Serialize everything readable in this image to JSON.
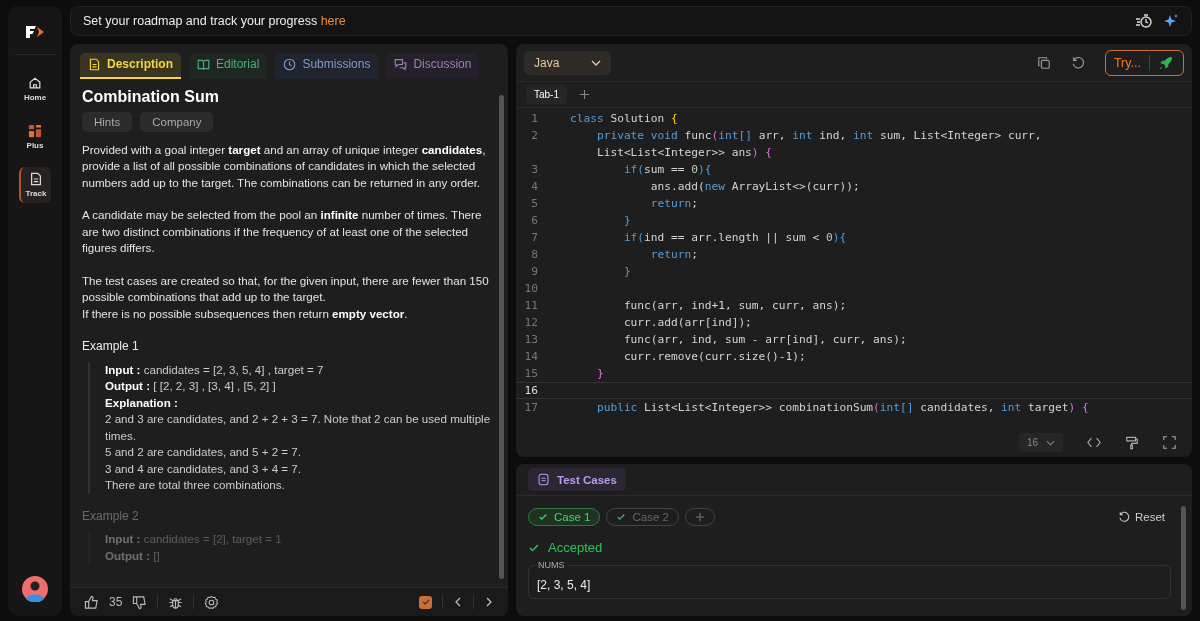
{
  "sidebar": {
    "items": [
      {
        "label": "Home",
        "kind": "home",
        "selected": false
      },
      {
        "label": "Plus",
        "kind": "plus",
        "selected": false
      },
      {
        "label": "Track",
        "kind": "track",
        "selected": true
      }
    ]
  },
  "banner": {
    "text": "Set your roadmap and track your progress",
    "link": "here"
  },
  "problem": {
    "tabs": [
      {
        "label": "Description",
        "kind": "description",
        "selected": true
      },
      {
        "label": "Editorial",
        "kind": "editorial",
        "selected": false
      },
      {
        "label": "Submissions",
        "kind": "submissions",
        "selected": false
      },
      {
        "label": "Discussion",
        "kind": "discussion",
        "selected": false
      }
    ],
    "title": "Combination Sum",
    "chips": [
      "Hints",
      "Company"
    ],
    "paragraphs": [
      [
        "Provided with a goal integer **target** and an array of unique integer **candidates**, provide a list of all possible combinations of candidates in which the selected numbers add up to the target. The combinations can be returned in any order."
      ],
      [
        "A candidate may be selected from the pool an **infinite** number of times. There are two distinct combinations if the frequency of at least one of the selected figures differs."
      ],
      [
        "The test cases are created so that, for the given input, there are fewer than 150 possible combinations that add up to the target.",
        "If there is no possible subsequences then return **empty vector**."
      ]
    ],
    "examples": [
      {
        "title": "Example 1",
        "faded": false,
        "lines": [
          "**Input :** candidates = [2, 3, 5, 4] , target = 7",
          "**Output :** [ [2, 2, 3] , [3, 4] , [5, 2] ]",
          "**Explanation :**",
          "2 and 3 are candidates, and 2 + 2 + 3 = 7. Note that 2 can be used multiple times.",
          "5 and 2 are candidates, and 5 + 2 = 7.",
          "3 and 4 are candidates, and 3 + 4 = 7.",
          "There are total three combinations."
        ]
      },
      {
        "title": "Example 2",
        "faded": true,
        "lines": [
          "**Input :** candidates = [2], target = 1",
          "**Output :** []"
        ]
      }
    ],
    "likes": "35",
    "solved": true
  },
  "editor": {
    "language": "Java",
    "try_button": "Try...",
    "tabs": [
      {
        "label": "Tab-1",
        "selected": true
      }
    ],
    "font_size": "16",
    "lines": [
      {
        "num": "1",
        "active": false,
        "tokens": [
          {
            "text": "class",
            "kind": "keyword"
          },
          {
            "text": " Solution ",
            "kind": "plain"
          },
          {
            "text": "{",
            "kind": "bracket1"
          }
        ]
      },
      {
        "num": "2",
        "active": false,
        "tokens": [
          {
            "text": "    private void",
            "kind": "keyword"
          },
          {
            "text": " func",
            "kind": "plain"
          },
          {
            "text": "(",
            "kind": "bracket2"
          },
          {
            "text": "int[]",
            "kind": "keyword"
          },
          {
            "text": " arr, ",
            "kind": "plain"
          },
          {
            "text": "int",
            "kind": "keyword"
          },
          {
            "text": " ind, ",
            "kind": "plain"
          },
          {
            "text": "int",
            "kind": "keyword"
          },
          {
            "text": " sum, List<Integer> curr,",
            "kind": "plain"
          }
        ]
      },
      {
        "active": false,
        "tokens": [
          {
            "text": "    List<List<Integer>> ans",
            "kind": "plain"
          },
          {
            "text": ") {",
            "kind": "bracket2"
          }
        ]
      },
      {
        "num": "3",
        "active": false,
        "tokens": [
          {
            "text": "        if",
            "kind": "keyword"
          },
          {
            "text": "(",
            "kind": "bracket3"
          },
          {
            "text": "sum == ",
            "kind": "plain"
          },
          {
            "text": "0",
            "kind": "number"
          },
          {
            "text": "){",
            "kind": "bracket3"
          }
        ]
      },
      {
        "num": "4",
        "active": false,
        "tokens": [
          {
            "text": "            ans.add(",
            "kind": "plain"
          },
          {
            "text": "new",
            "kind": "keyword"
          },
          {
            "text": " ArrayList<>(curr));",
            "kind": "plain"
          }
        ]
      },
      {
        "num": "5",
        "active": false,
        "tokens": [
          {
            "text": "            return",
            "kind": "keyword"
          },
          {
            "text": ";",
            "kind": "plain"
          }
        ]
      },
      {
        "num": "6",
        "active": false,
        "tokens": [
          {
            "text": "        }",
            "kind": "bracket3"
          }
        ]
      },
      {
        "num": "7",
        "active": false,
        "tokens": [
          {
            "text": "        if",
            "kind": "keyword"
          },
          {
            "text": "(",
            "kind": "bracket3"
          },
          {
            "text": "ind == arr.length || sum < ",
            "kind": "plain"
          },
          {
            "text": "0",
            "kind": "number"
          },
          {
            "text": "){",
            "kind": "bracket3"
          }
        ]
      },
      {
        "num": "8",
        "active": false,
        "tokens": [
          {
            "text": "            return",
            "kind": "keyword"
          },
          {
            "text": ";",
            "kind": "plain"
          }
        ]
      },
      {
        "num": "9",
        "active": false,
        "tokens": [
          {
            "text": "        }",
            "kind": "bracket3"
          }
        ]
      },
      {
        "num": "10",
        "active": false
      },
      {
        "num": "11",
        "active": false,
        "tokens": [
          {
            "text": "        func(arr, ind+1, sum, curr, ans);",
            "kind": "plain"
          }
        ]
      },
      {
        "num": "12",
        "active": false,
        "tokens": [
          {
            "text": "        curr.add(arr[ind]);",
            "kind": "plain"
          }
        ]
      },
      {
        "num": "13",
        "active": false,
        "tokens": [
          {
            "text": "        func(arr, ind, sum - arr[ind], curr, ans);",
            "kind": "plain"
          }
        ]
      },
      {
        "num": "14",
        "active": false,
        "tokens": [
          {
            "text": "        curr.remove(curr.size()-1);",
            "kind": "plain"
          }
        ]
      },
      {
        "num": "15",
        "active": false,
        "tokens": [
          {
            "text": "    }",
            "kind": "bracket2"
          }
        ]
      },
      {
        "num": "16",
        "active": true
      },
      {
        "num": "17",
        "active": false,
        "tokens": [
          {
            "text": "    public",
            "kind": "keyword"
          },
          {
            "text": " List<List<Integer>> combinationSum",
            "kind": "plain"
          },
          {
            "text": "(",
            "kind": "bracket2"
          },
          {
            "text": "int[]",
            "kind": "keyword"
          },
          {
            "text": " candidates, ",
            "kind": "plain"
          },
          {
            "text": "int",
            "kind": "keyword"
          },
          {
            "text": " target",
            "kind": "plain"
          },
          {
            "text": ") {",
            "kind": "bracket2"
          }
        ]
      }
    ]
  },
  "tests": {
    "tab": "Test Cases",
    "cases": [
      {
        "label": "Case 1",
        "selected": true
      },
      {
        "label": "Case 2",
        "selected": false
      }
    ],
    "reset": "Reset",
    "result": "Accepted",
    "inputs": [
      {
        "name": "NUMS",
        "value": "[2, 3, 5, 4]"
      }
    ]
  }
}
